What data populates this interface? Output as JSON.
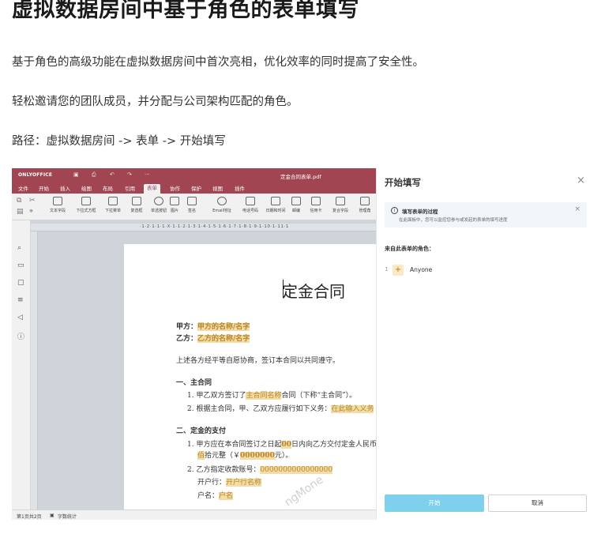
{
  "article": {
    "title": "虚拟数据房间中基于角色的表单填写",
    "p1": "基于角色的高级功能在虚拟数据房间中首次亮相，优化效率的同时提高了安全性。",
    "p2": "轻松邀请您的团队成员，并分配与公司架构匹配的角色。",
    "p3": "路径：虚拟数据房间 -> 表单 -> 开始填写"
  },
  "editor": {
    "brand": "ONLYOFFICE",
    "filename": "定金合同表单.pdf",
    "menu": [
      "文件",
      "开始",
      "插入",
      "绘图",
      "布局",
      "引用",
      "表单",
      "协作",
      "保护",
      "视图",
      "插件"
    ],
    "active_menu": "表单",
    "toolbar": [
      "文本字段",
      "下拉式方框",
      "下拉菜单",
      "复选框",
      "单选按钮",
      "图片",
      "签名",
      "Email地址",
      "电话号码",
      "日期和时间",
      "邮编",
      "信用卡",
      "复合字段",
      "管理角"
    ],
    "ruler_text": "·1·2·1·1·1·X·1·1·2·1·3·1·4·1·5·1·6·1·7·1·8·1·9·1·10·1·11·1",
    "status": {
      "page": "第1页共2页",
      "wordcount": "字数统计"
    },
    "icons": [
      "search-icon",
      "comment-icon",
      "chat-icon",
      "navigation-icon",
      "speaker-icon",
      "info-icon"
    ]
  },
  "document": {
    "title": "定金合同",
    "party_a_label": "甲方：",
    "party_a_field": "甲方的名称/名字",
    "party_b_label": "乙方：",
    "party_b_field": "乙方的名称/名字",
    "intro": "上述各方经平等自愿协商，签订本合同以共同遵守。",
    "sec1": "一、主合同",
    "s1_1a": "1.  甲乙双方签订了",
    "s1_1f": "主合同名称",
    "s1_1b": "合同（下称“主合同”）。",
    "s1_2a": "2.  根据主合同，甲、乙双方应履行如下义务：",
    "s1_2f": "在此输入义务",
    "sec2": "二、定金的支付",
    "s2_1a": "1.  甲方应在本合同签订之日起",
    "s2_1f": "00",
    "s2_1b": "日内向乙方交付定金人民币",
    "s2_1c": "佰",
    "s2_1d": "拾元整（￥",
    "s2_1e": "0000000",
    "s2_1g": "元）。",
    "s2_2a": "2.  乙方指定收款账号：",
    "s2_2f": "0000000000000000",
    "bank_label": "开户行：",
    "bank_field": "开户行名称",
    "name_label": "户名：",
    "name_field": "户名",
    "watermark": "ngMone"
  },
  "panel": {
    "title": "开始填写",
    "close": "×",
    "info_title": "填写表单的过程",
    "info_desc": "在此面板中，您可以监控您参与或发起的表单的填写进度",
    "info_close": "×",
    "roles_label": "来自此表单的角色：",
    "roles": [
      {
        "num": "1",
        "name": "Anyone"
      }
    ],
    "start_button": "开始",
    "cancel_button": "取消"
  }
}
